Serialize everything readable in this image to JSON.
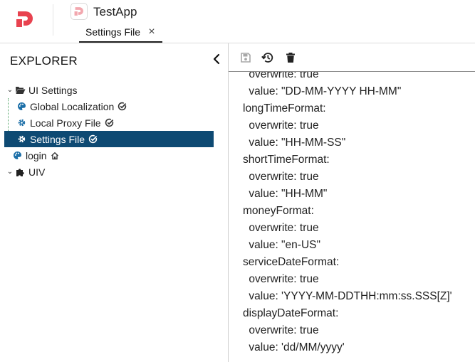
{
  "app": {
    "title": "TestApp"
  },
  "tabs": [
    {
      "label": "Settings File",
      "close_icon": "close-icon"
    }
  ],
  "explorer": {
    "title": "EXPLORER",
    "tree": [
      {
        "label": "UI Settings",
        "icon": "folder-open-icon",
        "expanded": true,
        "level": 0
      },
      {
        "label": "Global Localization",
        "icon": "palette-icon",
        "badge": "check-circle-icon",
        "level": 1
      },
      {
        "label": "Local Proxy File",
        "icon": "gear-icon",
        "badge": "check-circle-icon",
        "level": 1
      },
      {
        "label": "Settings File",
        "icon": "gear-icon",
        "badge": "check-circle-icon",
        "level": 1,
        "selected": true
      },
      {
        "label": "login",
        "icon": "palette-icon",
        "badge": "home-icon",
        "level": 0
      },
      {
        "label": "UIV",
        "icon": "puzzle-icon",
        "expanded": true,
        "level": 0
      }
    ]
  },
  "toolbar": {
    "buttons": [
      {
        "name": "save-button",
        "icon": "save-icon",
        "enabled": false
      },
      {
        "name": "history-button",
        "icon": "history-icon",
        "enabled": true
      },
      {
        "name": "delete-button",
        "icon": "trash-icon",
        "enabled": true
      }
    ]
  },
  "editor": {
    "lines": [
      "  overwrite: true",
      "  value: \"DD-MM-YYYY HH-MM\"",
      "longTimeFormat:",
      "  overwrite: true",
      "  value: \"HH-MM-SS\"",
      "shortTimeFormat:",
      "  overwrite: true",
      "  value: \"HH-MM\"",
      "moneyFormat:",
      "  overwrite: true",
      "  value: \"en-US\"",
      "serviceDateFormat:",
      "  overwrite: true",
      "  value: 'YYYY-MM-DDTHH:mm:ss.SSS[Z]'",
      "displayDateFormat:",
      "  overwrite: true",
      "  value: 'dd/MM/yyyy'"
    ]
  },
  "colors": {
    "brand": "#e8424f",
    "selection": "#0e4a73",
    "tree_guide": "#56a56a"
  }
}
